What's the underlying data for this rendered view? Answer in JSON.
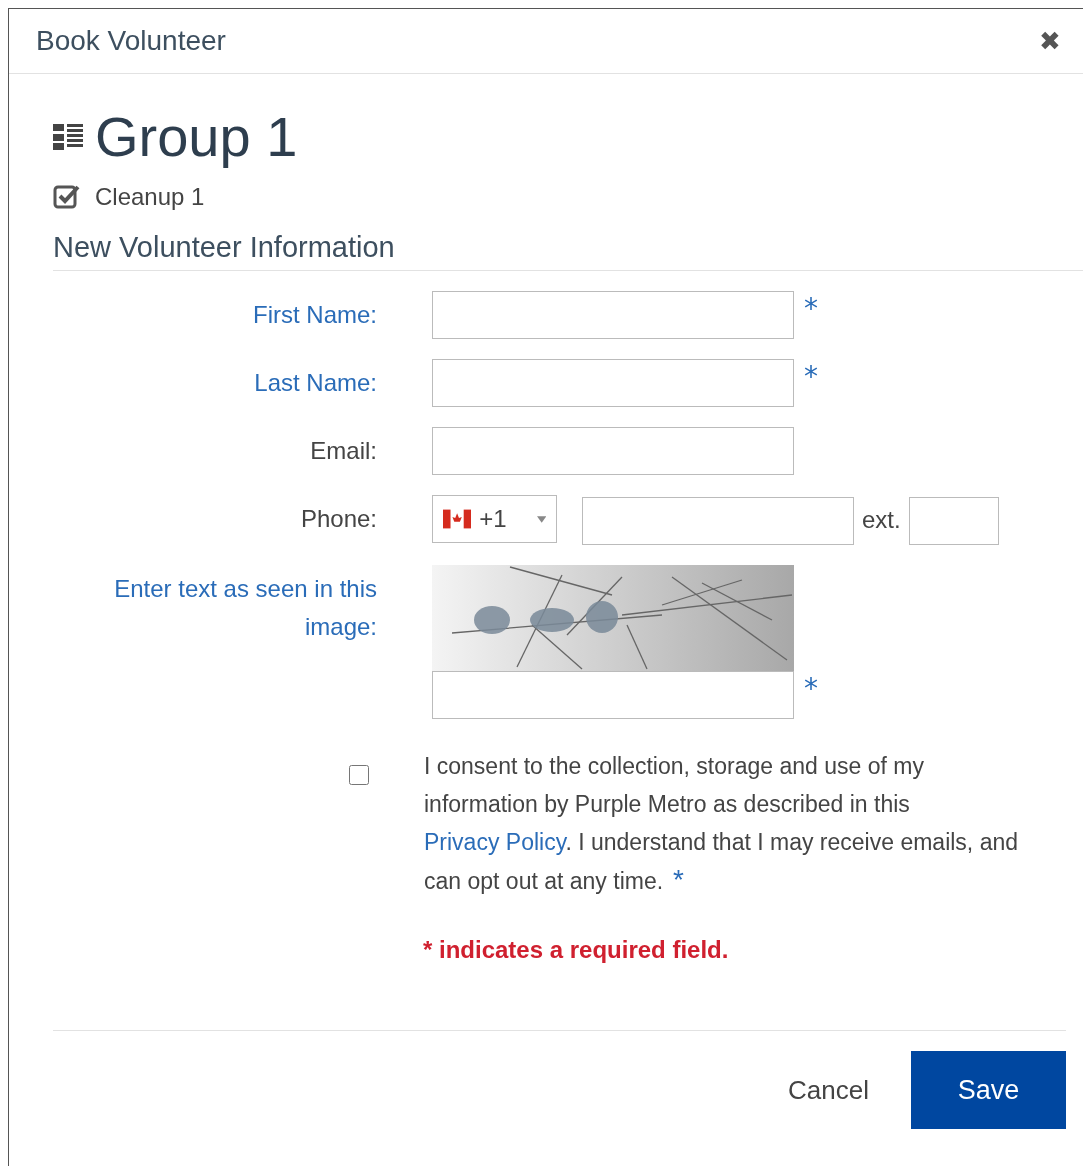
{
  "dialog": {
    "title": "Book Volunteer",
    "close": "✖"
  },
  "group": {
    "title": "Group 1",
    "activity": "Cleanup 1"
  },
  "section_title": "New Volunteer Information",
  "required_mark": "*",
  "fields": [
    {
      "kind": "text",
      "label": "First Name:",
      "required": true
    },
    {
      "kind": "text",
      "label": "Last Name:",
      "required": true
    },
    {
      "kind": "text",
      "label": "Email:",
      "required": false
    },
    {
      "kind": "phone",
      "label": "Phone:",
      "required": false,
      "country_code": "+1",
      "ext_label": "ext."
    },
    {
      "kind": "captcha",
      "label": "Enter text as seen in this image:",
      "required": true
    }
  ],
  "consent": {
    "checked": false,
    "before": "I consent to the collection, storage and use of my information by Purple Metro as described in this",
    "link": "Privacy Policy",
    "after": ". I understand that I may receive emails, and can opt out at any time.",
    "required": true
  },
  "required_note": "* indicates a required field.",
  "buttons": {
    "cancel": "Cancel",
    "save": "Save"
  }
}
